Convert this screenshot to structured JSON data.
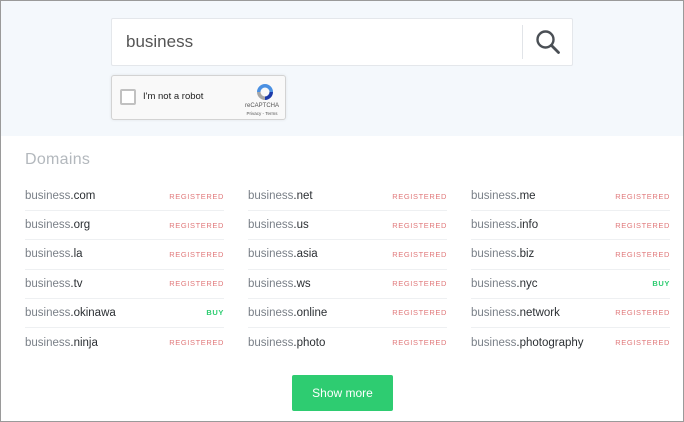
{
  "search": {
    "value": "business",
    "button_icon": "search-icon"
  },
  "captcha": {
    "label": "I'm not a robot",
    "brand": "reCAPTCHA",
    "links": "Privacy - Terms",
    "logo_icon": "recaptcha-icon"
  },
  "domains": {
    "title": "Domains",
    "registered_color": "#e0787a",
    "buy_color": "#2ecc71",
    "columns": [
      [
        {
          "sld": "business",
          "tld": ".com",
          "status": "REGISTERED"
        },
        {
          "sld": "business",
          "tld": ".org",
          "status": "REGISTERED"
        },
        {
          "sld": "business",
          "tld": ".la",
          "status": "REGISTERED"
        },
        {
          "sld": "business",
          "tld": ".tv",
          "status": "REGISTERED"
        },
        {
          "sld": "business",
          "tld": ".okinawa",
          "status": "BUY"
        },
        {
          "sld": "business",
          "tld": ".ninja",
          "status": "REGISTERED"
        }
      ],
      [
        {
          "sld": "business",
          "tld": ".net",
          "status": "REGISTERED"
        },
        {
          "sld": "business",
          "tld": ".us",
          "status": "REGISTERED"
        },
        {
          "sld": "business",
          "tld": ".asia",
          "status": "REGISTERED"
        },
        {
          "sld": "business",
          "tld": ".ws",
          "status": "REGISTERED"
        },
        {
          "sld": "business",
          "tld": ".online",
          "status": "REGISTERED"
        },
        {
          "sld": "business",
          "tld": ".photo",
          "status": "REGISTERED"
        }
      ],
      [
        {
          "sld": "business",
          "tld": ".me",
          "status": "REGISTERED"
        },
        {
          "sld": "business",
          "tld": ".info",
          "status": "REGISTERED"
        },
        {
          "sld": "business",
          "tld": ".biz",
          "status": "REGISTERED"
        },
        {
          "sld": "business",
          "tld": ".nyc",
          "status": "BUY"
        },
        {
          "sld": "business",
          "tld": ".network",
          "status": "REGISTERED"
        },
        {
          "sld": "business",
          "tld": ".photography",
          "status": "REGISTERED"
        }
      ]
    ]
  },
  "show_more": {
    "label": "Show more",
    "color": "#2ecc71"
  }
}
